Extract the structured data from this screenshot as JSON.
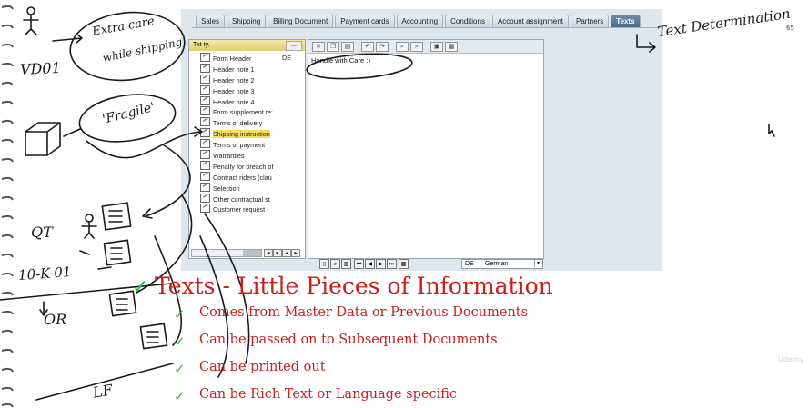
{
  "tabs": [
    "Sales",
    "Shipping",
    "Billing Document",
    "Payment cards",
    "Accounting",
    "Conditions",
    "Account assignment",
    "Partners",
    "Texts"
  ],
  "active_tab": "Texts",
  "text_types": {
    "header": "Txt ty.",
    "header_button": "...",
    "items": [
      {
        "label": "Form Header",
        "code": "DE"
      },
      {
        "label": "Header note 1"
      },
      {
        "label": "Header note 2"
      },
      {
        "label": "Header note 3"
      },
      {
        "label": "Header note 4"
      },
      {
        "label": "Form supplement te:"
      },
      {
        "label": "Terms of delivery"
      },
      {
        "label": "Shipping instruction",
        "selected": true
      },
      {
        "label": "Terms of payment"
      },
      {
        "label": "Warranties"
      },
      {
        "label": "Penalty for breach of"
      },
      {
        "label": "Contract riders (clau"
      },
      {
        "label": "Selection"
      },
      {
        "label": "Other contractual st"
      },
      {
        "label": "Customer request"
      }
    ]
  },
  "editor": {
    "content": "Handle with Care :)"
  },
  "language": {
    "code": "DE",
    "name": "German"
  },
  "page_number": "65",
  "watermark": "Udemy",
  "slide": {
    "title": "Texts - Little Pieces of Information",
    "bullets": [
      "Comes from Master Data or Previous Documents",
      "Can be passed on to Subsequent Documents",
      "Can be printed out",
      "Can be Rich Text or Language specific"
    ],
    "check_mark": "✓"
  },
  "handwriting": {
    "extra_care": "Extra care",
    "while_shipping": "while shipping",
    "fragile": "'Fragile'",
    "text_determination": "Text Determination",
    "vd01": "VD01",
    "qt": "QT",
    "ten_k_01": "10-K-01",
    "or": "OR",
    "lf": "LF"
  },
  "colors": {
    "title_red": "#c9201c",
    "check_green": "#2db63a",
    "active_tab": "#4a6787",
    "selected_row": "#f7de5c"
  }
}
